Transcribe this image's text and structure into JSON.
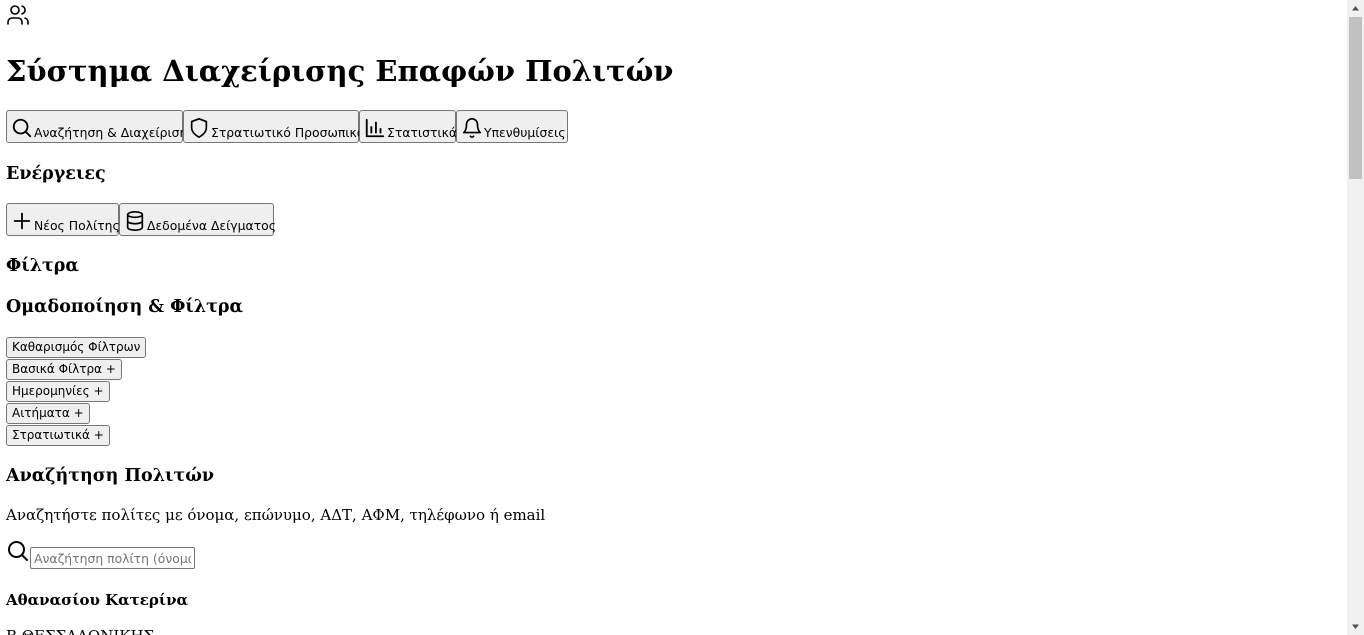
{
  "header": {
    "icon": "users-icon",
    "title": "Σύστημα Διαχείρισης Επαφών Πολιτών"
  },
  "tabs": [
    {
      "label": "Αναζήτηση & Διαχείριση",
      "icon": "search-icon"
    },
    {
      "label": "Στρατιωτικό Προσωπικό",
      "icon": "shield-icon"
    },
    {
      "label": "Στατιστικά",
      "icon": "bar-chart-icon"
    },
    {
      "label": "Υπενθυμίσεις",
      "icon": "bell-icon"
    }
  ],
  "actions": {
    "heading": "Ενέργειες",
    "new_citizen_label": "Νέος Πολίτης",
    "sample_data_label": "Δεδομένα Δείγματος"
  },
  "filters": {
    "heading": "Φίλτρα",
    "group_heading": "Ομαδοποίηση & Φίλτρα",
    "clear_label": "Καθαρισμός Φίλτρων",
    "sections": [
      "Βασικά Φίλτρα +",
      "Ημερομηνίες +",
      "Αιτήματα +",
      "Στρατιωτικά +"
    ]
  },
  "search": {
    "heading": "Αναζήτηση Πολιτών",
    "description": "Αναζητήστε πολίτες με όνομα, επώνυμο, ΑΔΤ, ΑΦΜ, τηλέφωνο ή email",
    "placeholder": "Αναζήτηση πολίτη (όνομα, επώνυμο, ΑΔΤ, ΑΦΜ...)",
    "value": ""
  },
  "results": [
    {
      "name": "Αθανασίου Κατερίνα",
      "location": "Β ΘΕΣΣΑΛΟΝΙΚΗΣ"
    }
  ]
}
